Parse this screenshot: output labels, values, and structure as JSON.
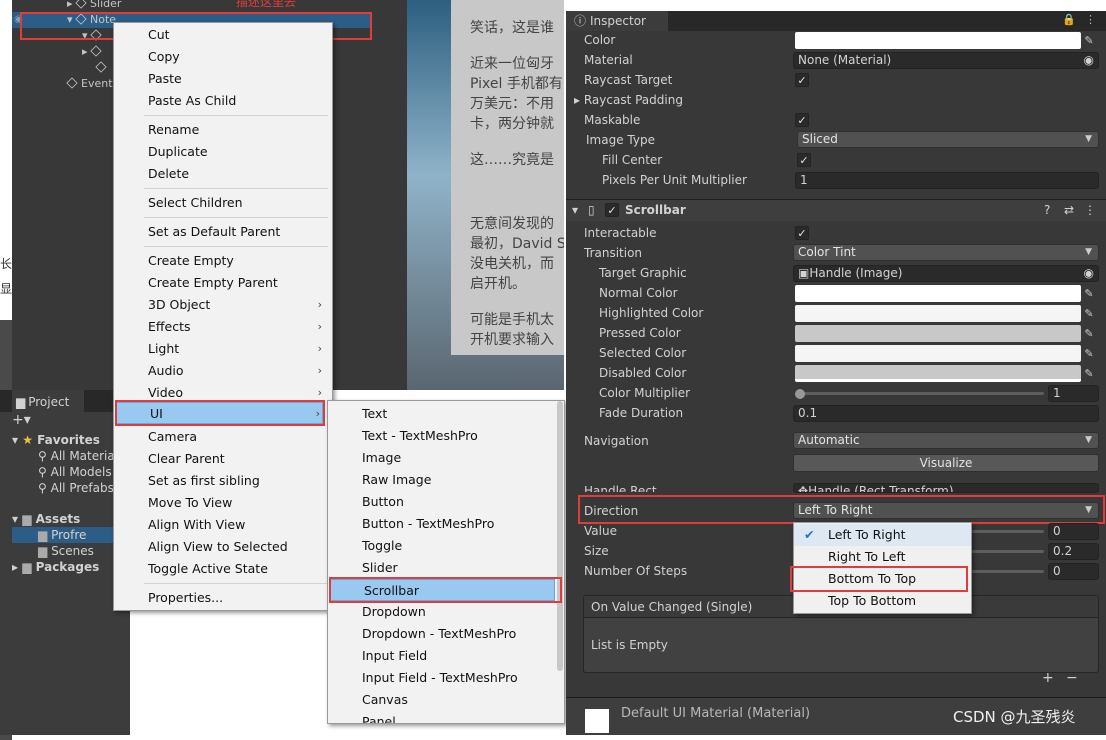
{
  "hierarchy": {
    "rows": [
      "Slider",
      "Note",
      "",
      "",
      "EventS"
    ],
    "overlay_text": "描述这里去"
  },
  "scene": {
    "paragraphs": [
      [
        "笑话，这是谁"
      ],
      [
        "近来一位匈牙",
        "Pixel 手机都有",
        "万美元：不用",
        "卡，两分钟就"
      ],
      [
        "这……究竟是"
      ],
      [
        "无意间发现的",
        "最初，David S",
        "没电关机，而",
        "启开机。"
      ],
      [
        "可能是手机太",
        "开机要求输入"
      ]
    ]
  },
  "left_strip": {
    "chars": [
      "长",
      "显"
    ]
  },
  "project": {
    "tab_label": "Project",
    "plus_label": "+▾",
    "favorites_label": "Favorites",
    "favorites_items": [
      "All Materia",
      "All Models",
      "All Prefabs"
    ],
    "assets_label": "Assets",
    "assets_items": [
      "Profre",
      "Scenes"
    ],
    "packages_label": "Packages"
  },
  "context_menu": {
    "items": [
      "Cut",
      "Copy",
      "Paste",
      "Paste As Child",
      "Rename",
      "Duplicate",
      "Delete",
      "Select Children",
      "Set as Default Parent",
      "Create Empty",
      "Create Empty Parent",
      "3D Object",
      "Effects",
      "Light",
      "Audio",
      "Video",
      "UI",
      "Camera",
      "Clear Parent",
      "Set as first sibling",
      "Move To View",
      "Align With View",
      "Align View to Selected",
      "Toggle Active State",
      "Properties..."
    ]
  },
  "ui_submenu": {
    "items": [
      "Text",
      "Text - TextMeshPro",
      "Image",
      "Raw Image",
      "Button",
      "Button - TextMeshPro",
      "Toggle",
      "Slider",
      "Scrollbar",
      "Dropdown",
      "Dropdown - TextMeshPro",
      "Input Field",
      "Input Field - TextMeshPro",
      "Canvas",
      "Panel"
    ]
  },
  "inspector": {
    "tab_label": "Inspector",
    "image": {
      "color_label": "Color",
      "material_label": "Material",
      "material_value": "None (Material)",
      "raycast_target_label": "Raycast Target",
      "raycast_padding_label": "Raycast Padding",
      "maskable_label": "Maskable",
      "image_type_label": "Image Type",
      "image_type_value": "Sliced",
      "fill_center_label": "Fill Center",
      "ppu_label": "Pixels Per Unit Multiplier",
      "ppu_value": "1"
    },
    "scrollbar": {
      "component_title": "Scrollbar",
      "interactable_label": "Interactable",
      "transition_label": "Transition",
      "transition_value": "Color Tint",
      "target_graphic_label": "Target Graphic",
      "target_graphic_value": "Handle (Image)",
      "normal_color_label": "Normal Color",
      "highlighted_color_label": "Highlighted Color",
      "pressed_color_label": "Pressed Color",
      "selected_color_label": "Selected Color",
      "disabled_color_label": "Disabled Color",
      "color_multiplier_label": "Color Multiplier",
      "color_multiplier_value": "1",
      "fade_duration_label": "Fade Duration",
      "fade_duration_value": "0.1",
      "navigation_label": "Navigation",
      "navigation_value": "Automatic",
      "visualize_label": "Visualize",
      "handle_rect_label": "Handle Rect",
      "handle_rect_value": "Handle (Rect Transform)",
      "direction_label": "Direction",
      "direction_value": "Left To Right",
      "value_label": "Value",
      "value_value": "0",
      "size_label": "Size",
      "size_value": "0.2",
      "steps_label": "Number Of Steps",
      "steps_value": "0",
      "event_header": "On Value Changed (Single)",
      "event_empty": "List is Empty",
      "add_label": "+",
      "remove_label": "−"
    },
    "material_footer": "Default UI Material (Material)"
  },
  "direction_dropdown": {
    "options": [
      "Left To Right",
      "Right To Left",
      "Bottom To Top",
      "Top To Bottom"
    ],
    "selected_mark": "✔"
  },
  "watermark": "CSDN @九圣残炎",
  "colors": {
    "highlight": "#99c9f0",
    "annotation_red": "#e03c3c",
    "selection_blue": "#2c5d87"
  }
}
